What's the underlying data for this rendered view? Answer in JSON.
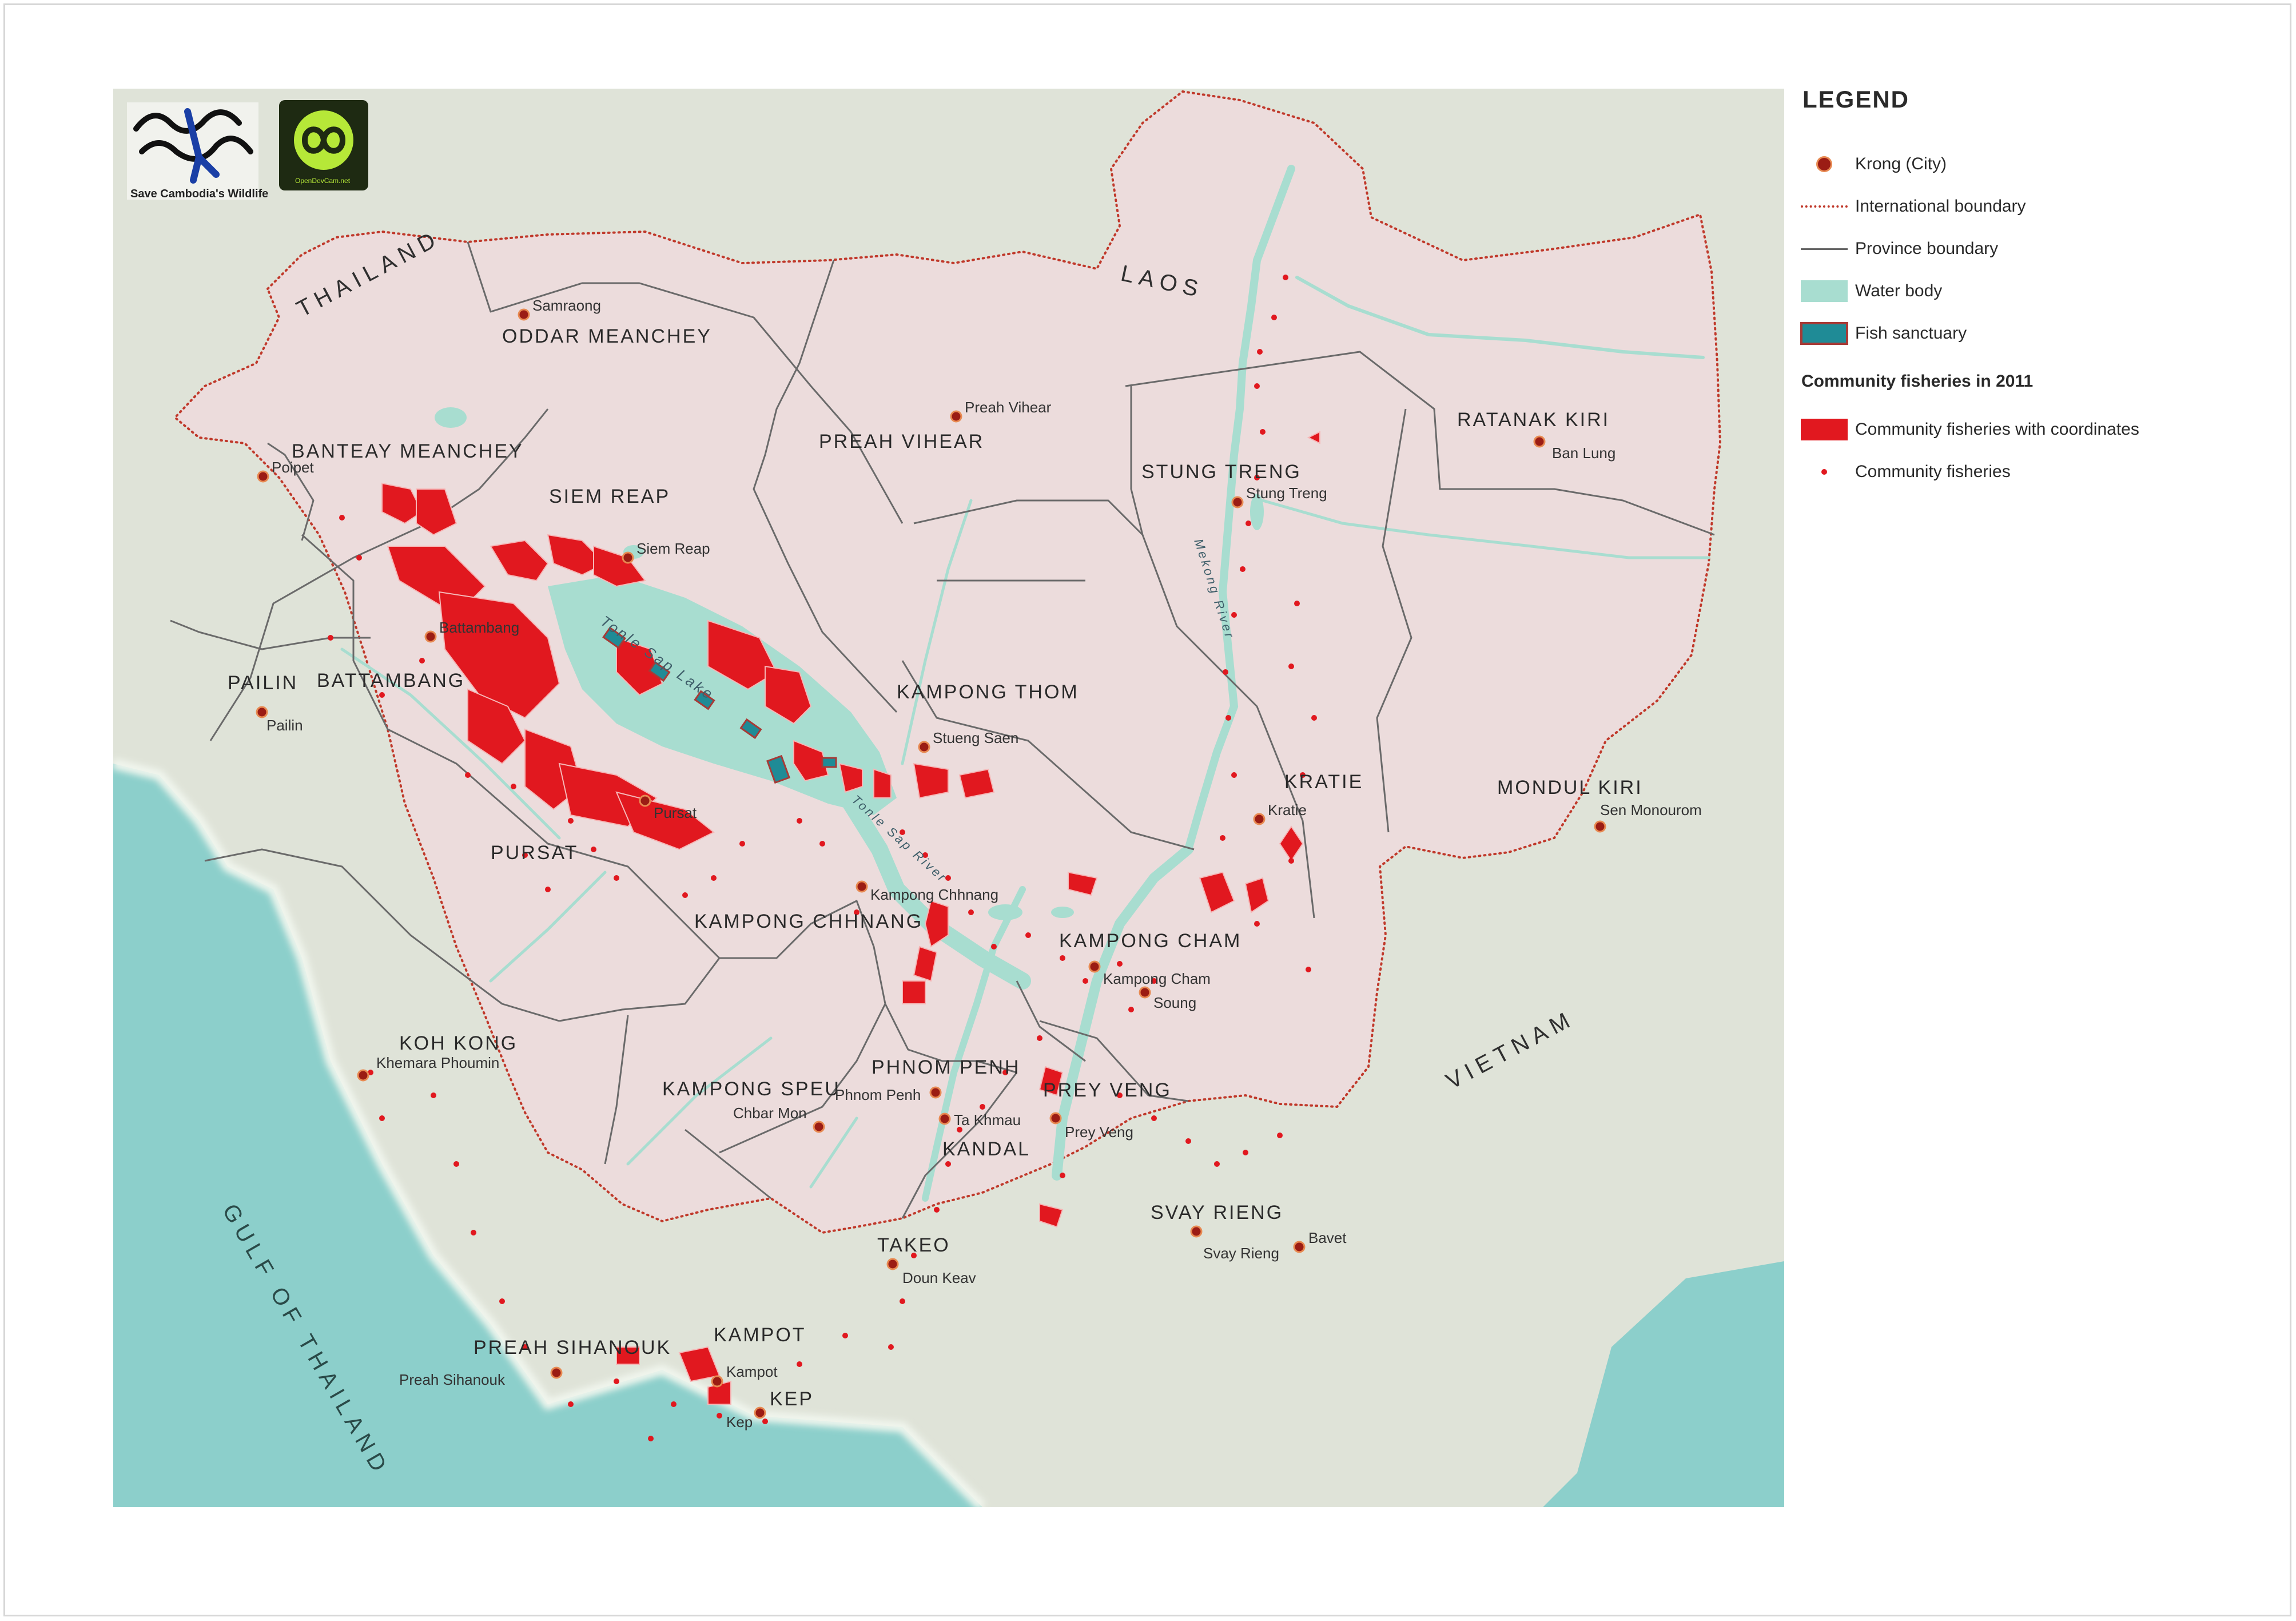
{
  "logos": {
    "scw_caption": "Save Cambodia's Wildlife",
    "odc_caption": "OpenDevCam.net"
  },
  "countries": {
    "thailand": "THAILAND",
    "laos": "LAOS",
    "vietnam": "VIETNAM",
    "gulf": "GULF OF THAILAND"
  },
  "provinces": [
    {
      "name": "ODDAR MEANCHEY"
    },
    {
      "name": "BANTEAY MEANCHEY"
    },
    {
      "name": "SIEM REAP"
    },
    {
      "name": "PREAH VIHEAR"
    },
    {
      "name": "STUNG TRENG"
    },
    {
      "name": "RATANAK KIRI"
    },
    {
      "name": "PAILIN"
    },
    {
      "name": "BATTAMBANG"
    },
    {
      "name": "KAMPONG THOM"
    },
    {
      "name": "KRATIE"
    },
    {
      "name": "MONDUL KIRI"
    },
    {
      "name": "PURSAT"
    },
    {
      "name": "KAMPONG CHHNANG"
    },
    {
      "name": "KAMPONG CHAM"
    },
    {
      "name": "KOH KONG"
    },
    {
      "name": "KAMPONG SPEU"
    },
    {
      "name": "PHNOM PENH"
    },
    {
      "name": "PREY VENG"
    },
    {
      "name": "KANDAL"
    },
    {
      "name": "SVAY RIENG"
    },
    {
      "name": "TAKEO"
    },
    {
      "name": "PREAH SIHANOUK"
    },
    {
      "name": "KAMPOT"
    },
    {
      "name": "KEP"
    }
  ],
  "cities": [
    {
      "name": "Samraong"
    },
    {
      "name": "Poipet"
    },
    {
      "name": "Siem Reap"
    },
    {
      "name": "Preah Vihear"
    },
    {
      "name": "Stung Treng"
    },
    {
      "name": "Ban Lung"
    },
    {
      "name": "Battambang"
    },
    {
      "name": "Pailin"
    },
    {
      "name": "Stueng Saen"
    },
    {
      "name": "Pursat"
    },
    {
      "name": "Kratie"
    },
    {
      "name": "Sen Monourom"
    },
    {
      "name": "Kampong Chhnang"
    },
    {
      "name": "Kampong Cham"
    },
    {
      "name": "Soung"
    },
    {
      "name": "Khemara Phoumin"
    },
    {
      "name": "Phnom Penh"
    },
    {
      "name": "Chbar Mon"
    },
    {
      "name": "Ta Khmau"
    },
    {
      "name": "Prey Veng"
    },
    {
      "name": "Svay Rieng"
    },
    {
      "name": "Bavet"
    },
    {
      "name": "Doun Keav"
    },
    {
      "name": "Kampot"
    },
    {
      "name": "Preah Sihanouk"
    },
    {
      "name": "Kep"
    }
  ],
  "water_labels": {
    "lake": "Tonle Sap Lake",
    "tonle_river": "Tonle Sap River",
    "mekong": "Mekong River"
  },
  "legend": {
    "title": "LEGEND",
    "items": [
      {
        "label": "Krong (City)",
        "symbol": "city"
      },
      {
        "label": "International boundary",
        "symbol": "intl"
      },
      {
        "label": "Province boundary",
        "symbol": "prov"
      },
      {
        "label": "Water body",
        "symbol": "water"
      },
      {
        "label": "Fish sanctuary",
        "symbol": "sanct"
      }
    ],
    "subtitle": "Community fisheries in 2011",
    "fisheries_items": [
      {
        "label": "Community fisheries with coordinates",
        "symbol": "cf"
      },
      {
        "label": "Community fisheries",
        "symbol": "dot"
      }
    ]
  },
  "colors": {
    "sea": "#8ccfcb",
    "land_outside": "#dfe3d8",
    "cambodia": "#ecdcdc",
    "water": "#a8ddd0",
    "fishery": "#e1181f",
    "sanctuary": "#1f8b96",
    "intl_boundary": "#c0392b",
    "province_boundary": "#6a6a6a",
    "city_dot": "#9b1c14"
  }
}
